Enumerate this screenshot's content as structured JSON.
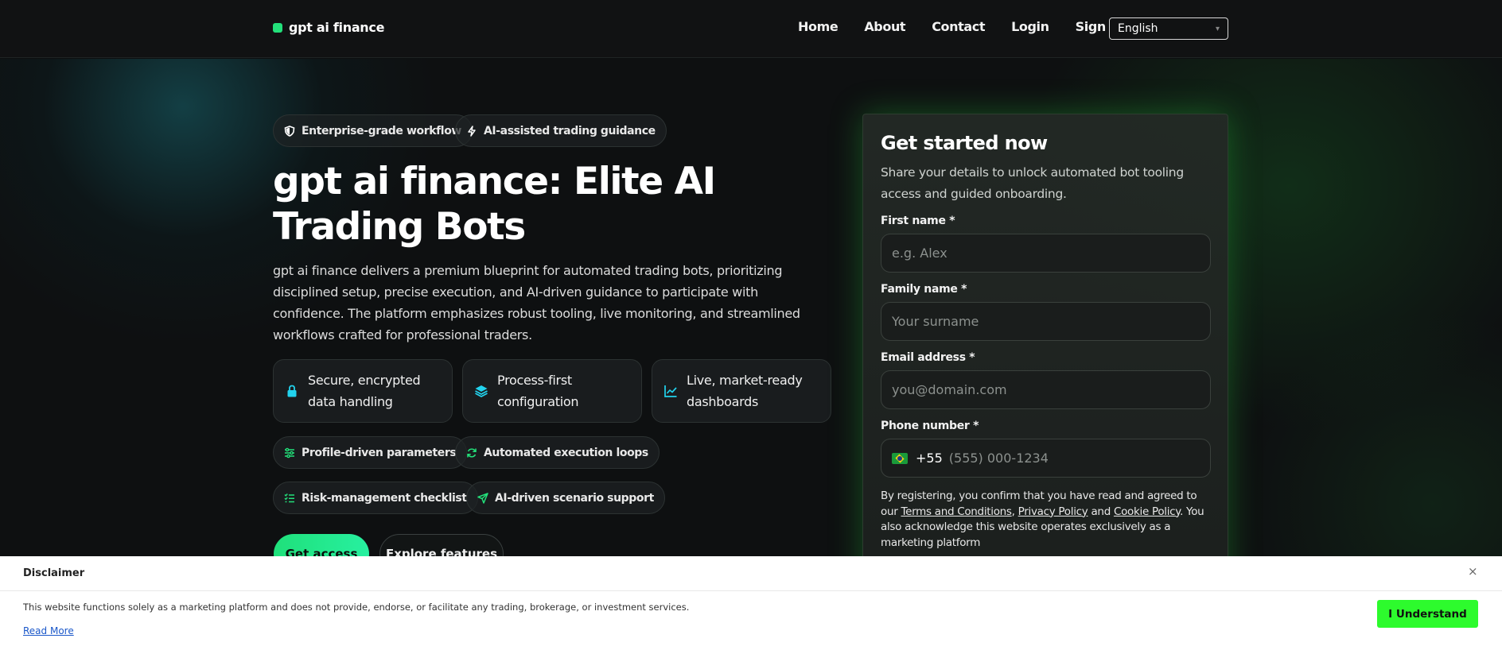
{
  "header": {
    "logo_text": "gpt ai finance",
    "nav": [
      "Home",
      "About",
      "Contact",
      "Login",
      "Sign Up"
    ],
    "language": "English"
  },
  "hero": {
    "badges": [
      "Enterprise-grade workflow",
      "AI-assisted trading guidance"
    ],
    "title": "gpt ai finance: Elite AI Trading Bots",
    "description": "gpt ai finance delivers a premium blueprint for automated trading bots, prioritizing disciplined setup, precise execution, and AI-driven guidance to participate with confidence. The platform emphasizes robust tooling, live monitoring, and streamlined workflows crafted for professional traders.",
    "features": [
      "Secure, encrypted data handling",
      "Process-first configuration",
      "Live, market-ready dashboards"
    ],
    "tags": [
      "Profile-driven parameters",
      "Automated execution loops",
      "Risk-management checklist",
      "AI-driven scenario support"
    ],
    "primary_button": "Get access",
    "secondary_button": "Explore features"
  },
  "form": {
    "title": "Get started now",
    "subtitle": "Share your details to unlock automated bot tooling access and guided onboarding.",
    "first_name_label": "First name *",
    "first_name_placeholder": "e.g. Alex",
    "family_name_label": "Family name *",
    "family_name_placeholder": "Your surname",
    "email_label": "Email address *",
    "email_placeholder": "you@domain.com",
    "phone_label": "Phone number *",
    "phone_code": "+55",
    "phone_placeholder": "(555) 000-1234",
    "legal_prefix": "By registering, you confirm that you have read and agreed to our ",
    "terms": "Terms and Conditions",
    "comma": ", ",
    "privacy": "Privacy Policy",
    "and": " and ",
    "cookie": "Cookie Policy",
    "legal_suffix": ". You also acknowledge this website operates exclusively as a marketing platform"
  },
  "disclaimer": {
    "title": "Disclaimer",
    "close": "×",
    "text": "This website functions solely as a marketing platform and does not provide, endorse, or facilitate any trading, brokerage, or investment services.",
    "read_more": "Read More",
    "button": "I Understand"
  },
  "colors": {
    "accent_green": "#23e07a",
    "accent_cyan": "#22d3ee",
    "understand_button": "#2dfb2d"
  },
  "icons": {
    "badge_0": "shield-icon",
    "badge_1": "bolt-icon",
    "feature_0": "lock-icon",
    "feature_1": "layers-icon",
    "feature_2": "chart-line-icon",
    "tag_0": "sliders-icon",
    "tag_1": "refresh-icon",
    "tag_2": "checklist-icon",
    "tag_3": "send-icon"
  }
}
